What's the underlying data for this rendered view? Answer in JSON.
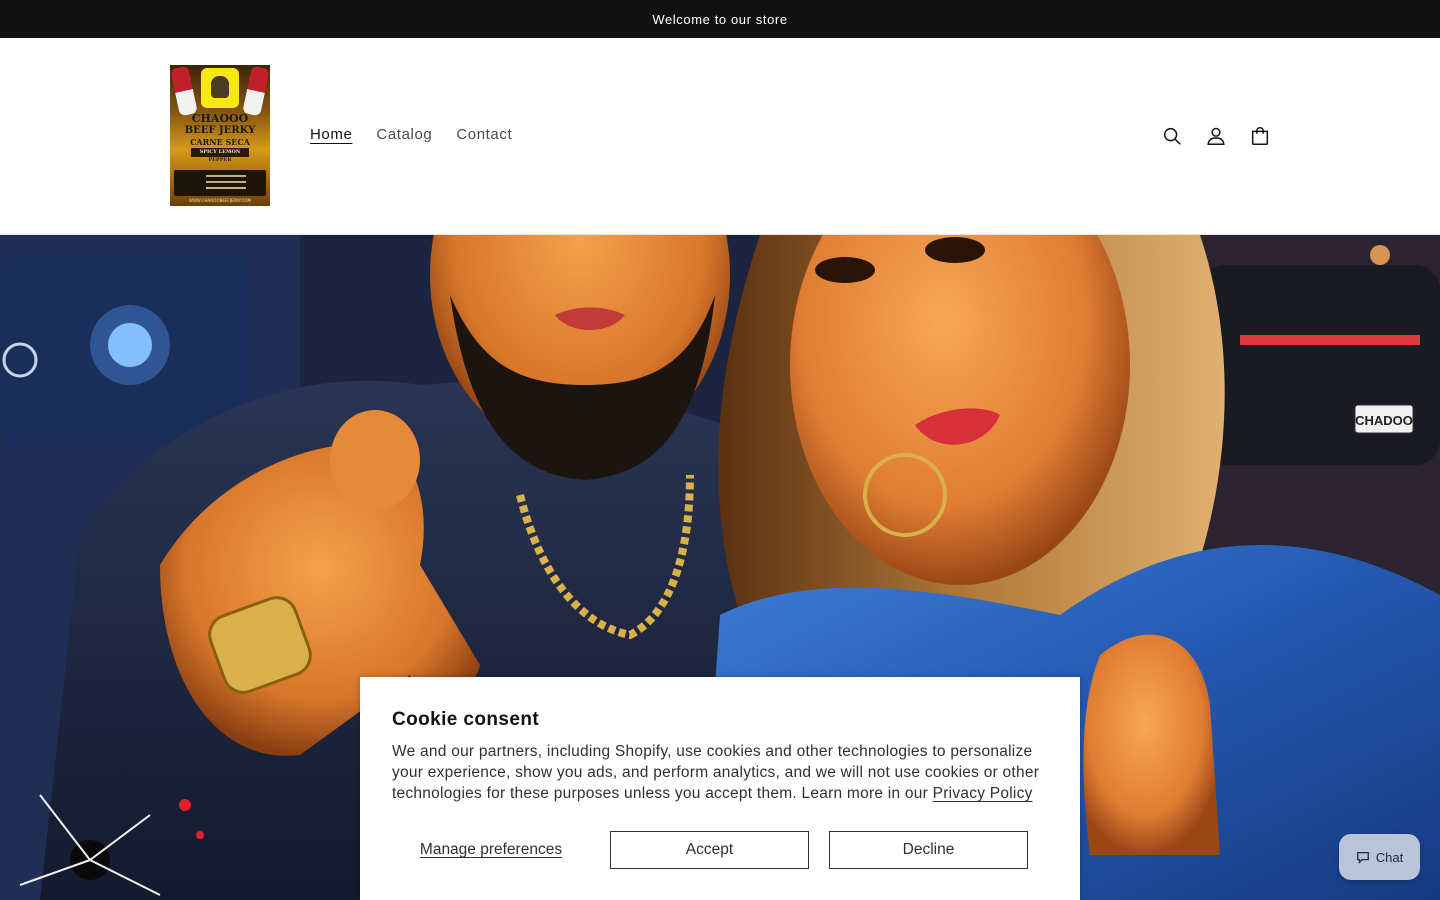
{
  "announcement": {
    "text": "Welcome to our store"
  },
  "header": {
    "logo": {
      "lines": [
        "CHAOOO",
        "BEEF JERKY",
        "CARNE SECA",
        "SPICY LEMON",
        "PEPPER",
        "WWW.CHAOOOBEEFJERKY.COM"
      ]
    },
    "nav": [
      {
        "label": "Home",
        "active": true
      },
      {
        "label": "Catalog",
        "active": false
      },
      {
        "label": "Contact",
        "active": false
      }
    ],
    "icons": [
      "search-icon",
      "account-icon",
      "cart-icon"
    ]
  },
  "hero": {
    "license_plate": "CHADOO"
  },
  "cookie": {
    "title": "Cookie consent",
    "body": "We and our partners, including Shopify, use cookies and other technologies to personalize your experience, show you ads, and perform analytics, and we will not use cookies or other technologies for these purposes unless you accept them. Learn more in our ",
    "privacy_link": "Privacy Policy",
    "manage_label": "Manage preferences",
    "accept_label": "Accept",
    "decline_label": "Decline"
  },
  "chat": {
    "label": "Chat",
    "icon": "chat-bubble-icon"
  },
  "colors": {
    "announcement_bg": "#121212",
    "text": "#121212",
    "chat_bg": "#b8c4d8"
  }
}
